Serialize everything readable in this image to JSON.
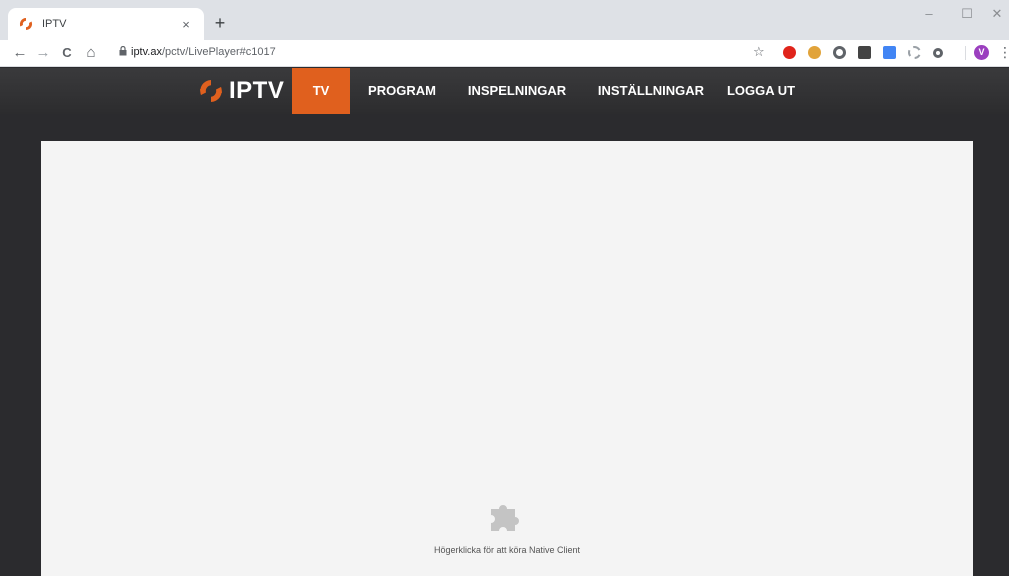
{
  "browser": {
    "tab": {
      "title": "IPTV",
      "close": "×"
    },
    "new_tab": "+",
    "window": {
      "minimize": "–",
      "maximize": "☐",
      "close": "✕"
    },
    "nav": {
      "back": "←",
      "forward": "→",
      "reload": "C",
      "home": "⌂"
    },
    "url": {
      "host": "iptv.ax",
      "path": "/pctv/LivePlayer#c1017"
    },
    "bookmark": "☆",
    "profile_initial": "V",
    "menu": "⋮"
  },
  "site": {
    "logo_text": "IPTV",
    "nav": [
      {
        "label": "TV",
        "active": true
      },
      {
        "label": "PROGRAM",
        "active": false
      },
      {
        "label": "INSPELNINGAR",
        "active": false
      },
      {
        "label": "INSTÄLLNINGAR",
        "active": false
      },
      {
        "label": "LOGGA UT",
        "active": false
      }
    ],
    "accent_color": "#e0601e"
  },
  "player": {
    "message": "Högerklicka för att köra Native Client"
  }
}
